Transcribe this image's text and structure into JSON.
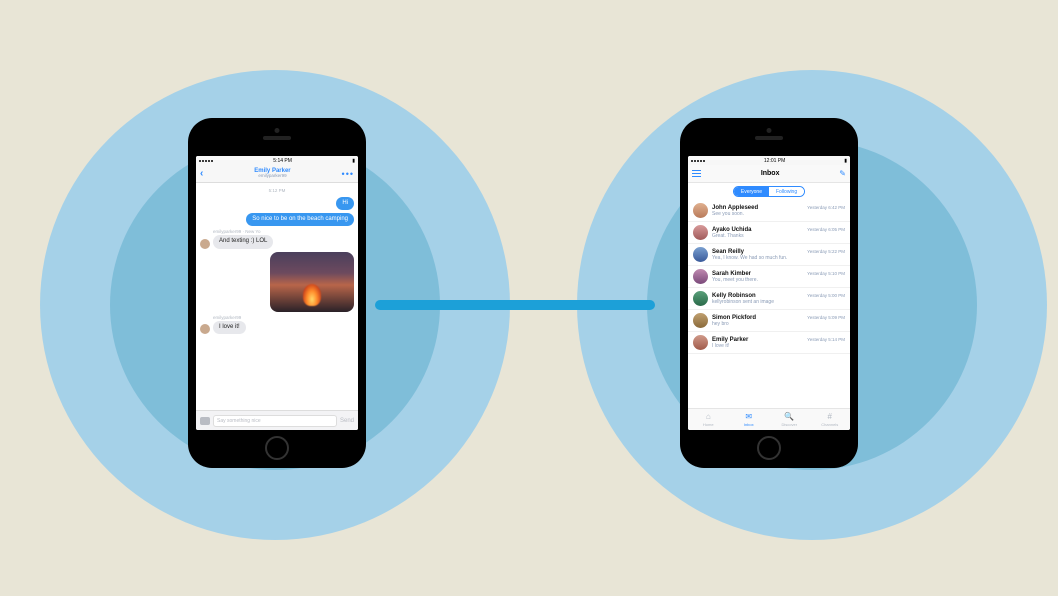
{
  "left_phone": {
    "status_time": "5:14 PM",
    "nav": {
      "contact_name": "Emily Parker",
      "contact_handle": "emilyparker99",
      "back": "‹",
      "more": "•••"
    },
    "timestamp": "5:12 PM",
    "msg_hi": "Hi",
    "msg_beach": "So nice to be on the beach camping",
    "sender_label_1": "emilyparker99 · New Yo",
    "msg_lol": "And texting :) LOL",
    "sender_label_2": "emilyparker99",
    "msg_love": "I love it!",
    "composer": {
      "placeholder": "Say something nice",
      "send": "Send"
    }
  },
  "right_phone": {
    "status_time": "12:01 PM",
    "nav_title": "Inbox",
    "seg": {
      "a": "Everyone",
      "b": "Following"
    },
    "inbox": [
      {
        "name": "John Appleseed",
        "preview": "See you soon.",
        "time": "Yesterday 6:42 PM"
      },
      {
        "name": "Ayako Uchida",
        "preview": "Great. Thanks",
        "time": "Yesterday 6:05 PM"
      },
      {
        "name": "Sean Reilly",
        "preview": "Yea, I know. We had so much fun.",
        "time": "Yesterday 5:22 PM"
      },
      {
        "name": "Sarah Kimber",
        "preview": "You, meet you there.",
        "time": "Yesterday 5:10 PM"
      },
      {
        "name": "Kelly Robinson",
        "preview": "kellyrobinson sent an image",
        "time": "Yesterday 5:00 PM"
      },
      {
        "name": "Simon Pickford",
        "preview": "hey bro",
        "time": "Yesterday 5:09 PM"
      },
      {
        "name": "Emily Parker",
        "preview": "I love it!",
        "time": "Yesterday 5:14 PM"
      }
    ],
    "tabs": {
      "home": "Home",
      "inbox": "Inbox",
      "discover": "Discover",
      "channels": "Channels"
    }
  }
}
